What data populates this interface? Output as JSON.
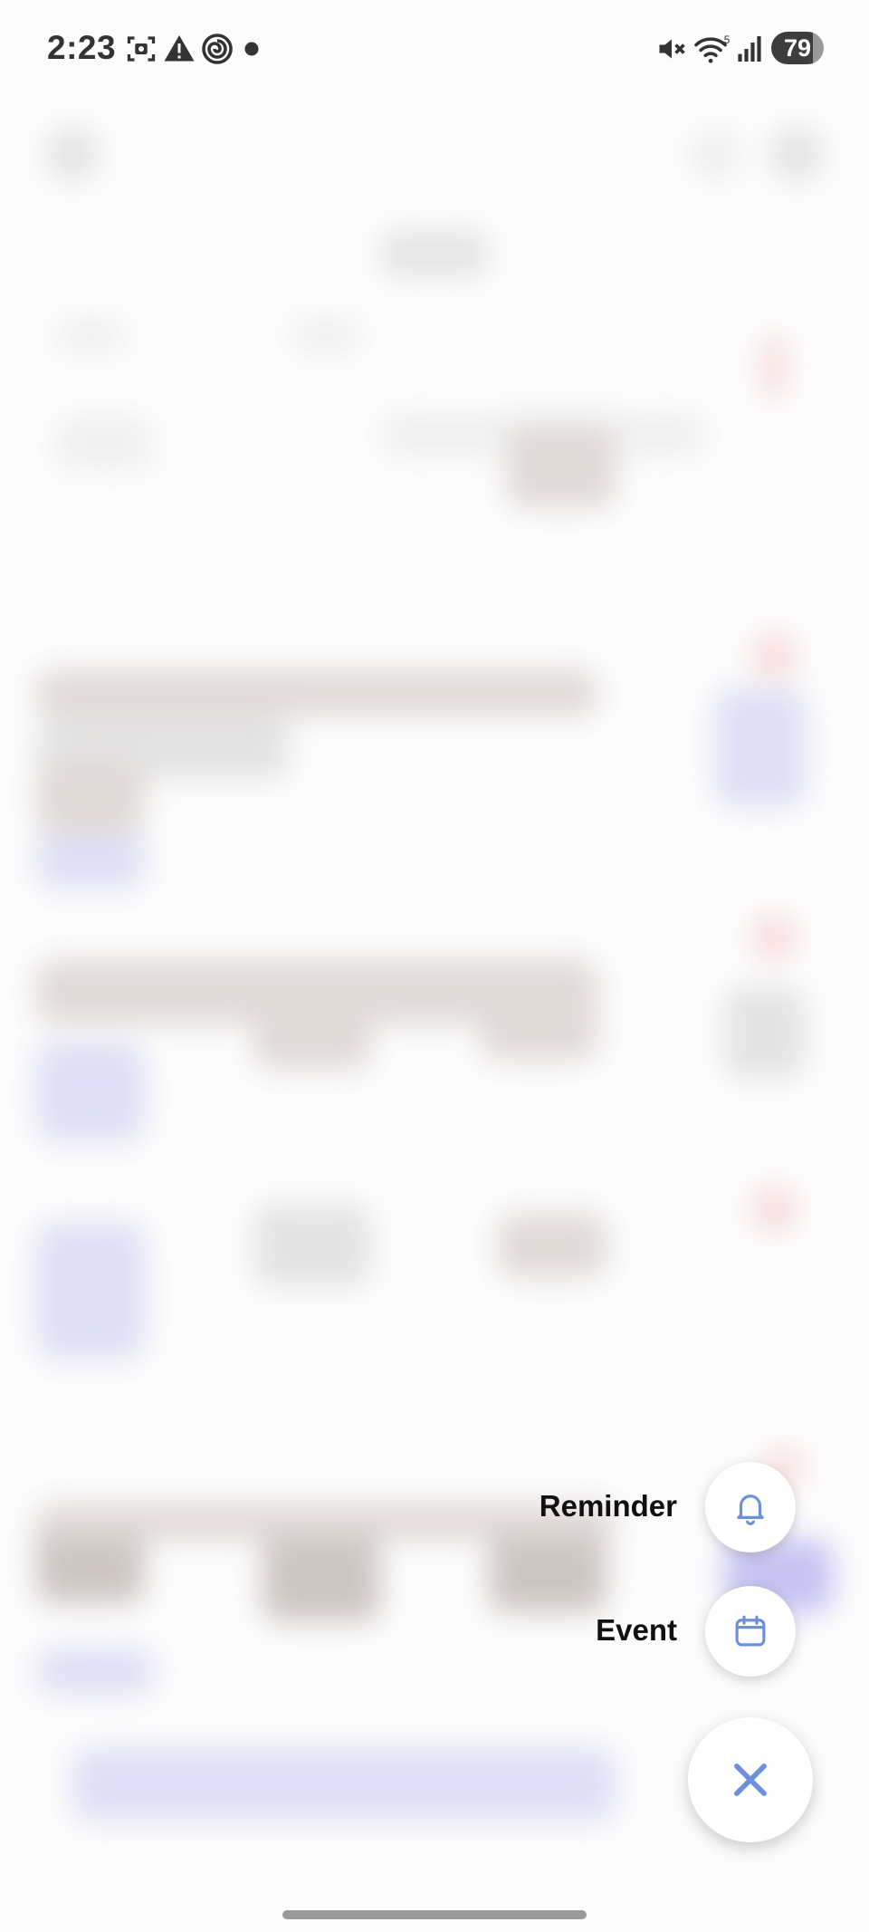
{
  "status_bar": {
    "time": "2:23",
    "battery_level": "79",
    "network_label": "5",
    "icons": [
      "screenshot-icon",
      "warning-icon",
      "spiral-icon",
      "notification-dot-icon",
      "mute-icon",
      "wifi-icon",
      "signal-icon",
      "battery-icon"
    ]
  },
  "fab_menu": {
    "items": [
      {
        "label": "Reminder",
        "icon": "bell-icon"
      },
      {
        "label": "Event",
        "icon": "calendar-icon"
      }
    ],
    "close_icon": "close-icon",
    "accent_color": "#6d8fe0"
  }
}
